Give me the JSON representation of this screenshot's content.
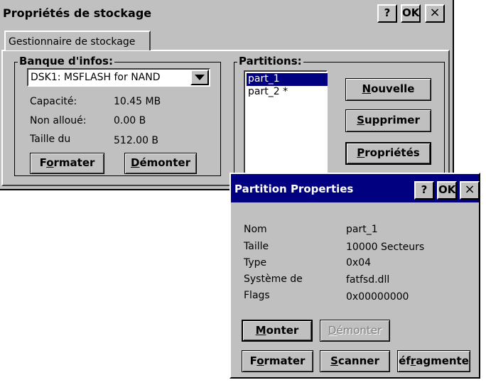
{
  "main_window": {
    "title": "Propriétés de stockage",
    "help_btn": "?",
    "ok_btn": "OK",
    "close_btn": "×",
    "tab": "Gestionnaire de stockage",
    "banque_label": "Banque d'infos:",
    "store_selected": "DSK1: MSFLASH for NAND",
    "info": [
      {
        "label": "Capacité:",
        "value": "10.45 MB"
      },
      {
        "label": "Non alloué:",
        "value": "0.00 B"
      },
      {
        "label": "Taille du",
        "value": "512.00 B"
      }
    ],
    "formater": {
      "pre": "F",
      "acc": "o",
      "post": "rmater"
    },
    "demonter": {
      "pre": "",
      "acc": "D",
      "post": "émonter"
    },
    "partitions_label": "Partitions:",
    "partitions": [
      "part_1",
      "part_2 *"
    ],
    "nouvelle": {
      "pre": "",
      "acc": "N",
      "post": "ouvelle"
    },
    "supprimer": {
      "pre": "",
      "acc": "S",
      "post": "upprimer"
    },
    "proprietes": {
      "pre": "",
      "acc": "P",
      "post": "ropriétés"
    }
  },
  "partition_window": {
    "title": "Partition Properties",
    "help_btn": "?",
    "ok_btn": "OK",
    "close_btn": "×",
    "props": [
      {
        "label": "Nom",
        "value": "part_1"
      },
      {
        "label": "Taille",
        "value": "10000 Secteurs"
      },
      {
        "label": "Type",
        "value": "0x04"
      },
      {
        "label": "Système de",
        "value": "fatfsd.dll"
      },
      {
        "label": "Flags",
        "value": "0x00000000"
      }
    ],
    "monter": {
      "pre": "",
      "acc": "M",
      "post": "onter"
    },
    "demonter": {
      "pre": "",
      "acc": "D",
      "post": "émonter"
    },
    "formater": {
      "pre": "F",
      "acc": "o",
      "post": "rmater"
    },
    "scanner": {
      "pre": "",
      "acc": "S",
      "post": "canner"
    },
    "defragmenter": {
      "pre": "éf",
      "acc": "r",
      "post": "agmente"
    }
  },
  "colors": {
    "face": "#c0c0c0",
    "titlebar_active": "#000080",
    "selection": "#000080"
  }
}
